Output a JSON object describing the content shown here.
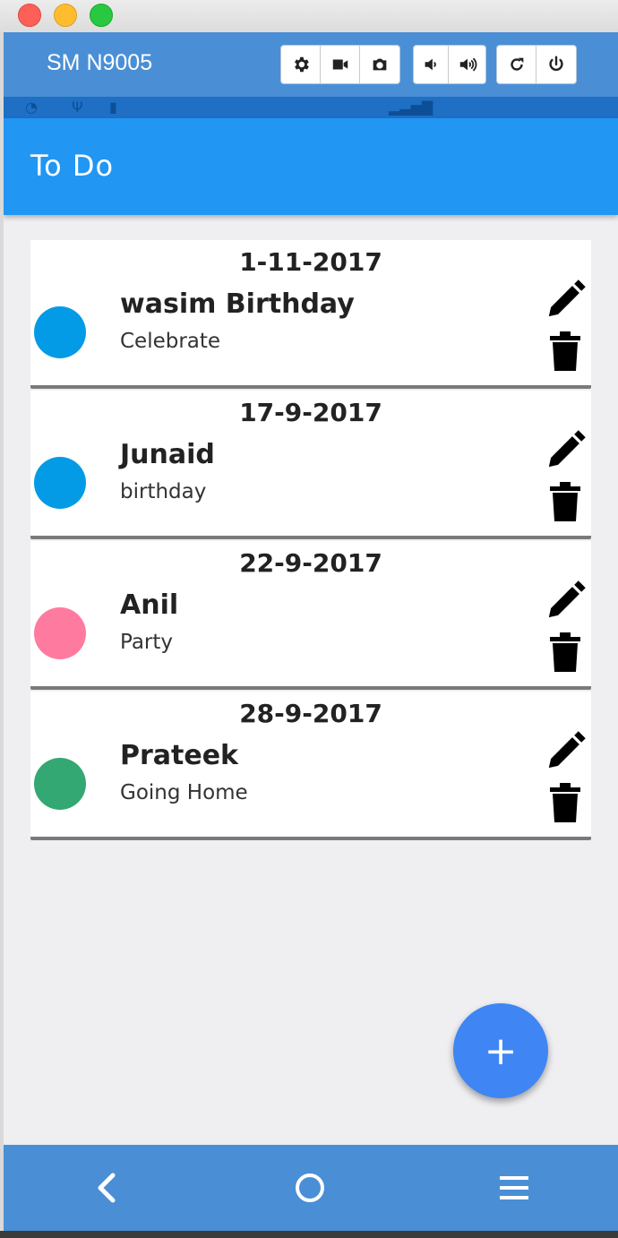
{
  "window": {
    "device_name": "SM N9005"
  },
  "toolbar": {
    "groups": [
      [
        "gear-icon",
        "video-camera-icon",
        "camera-icon"
      ],
      [
        "volume-down-icon",
        "volume-up-icon"
      ],
      [
        "rotate-icon",
        "power-icon"
      ]
    ]
  },
  "app": {
    "title": "To Do"
  },
  "todos": [
    {
      "date": "1-11-2017",
      "title": "wasim Birthday",
      "subtitle": "Celebrate",
      "color": "#039be5"
    },
    {
      "date": "17-9-2017",
      "title": "Junaid",
      "subtitle": "birthday",
      "color": "#039be5"
    },
    {
      "date": "22-9-2017",
      "title": "Anil",
      "subtitle": "Party",
      "color": "#ff7a9f"
    },
    {
      "date": "28-9-2017",
      "title": "Prateek",
      "subtitle": "Going Home",
      "color": "#34a873"
    }
  ],
  "fab": {
    "label": "+"
  },
  "colors": {
    "appbar": "#2196f3",
    "toolbar": "#4a8fd6",
    "fab": "#3f86f4"
  }
}
